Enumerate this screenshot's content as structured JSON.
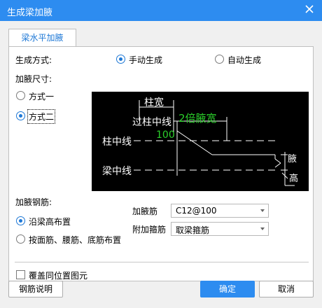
{
  "window": {
    "title": "生成梁加腋"
  },
  "tab": {
    "label": "梁水平加腋"
  },
  "generation": {
    "label": "生成方式:",
    "manual": "手动生成",
    "auto": "自动生成",
    "selected": "manual"
  },
  "size": {
    "label": "加腋尺寸:",
    "option1": "方式一",
    "option2": "方式二",
    "selected": "option2"
  },
  "diagram": {
    "col_width": "柱宽",
    "through_col_center": "过柱中线",
    "double_haunch_width": "2倍腋宽",
    "col_center_line": "柱中线",
    "value_100": "100",
    "beam_center_line": "梁中线",
    "haunch_label": "腋",
    "height_label": "高"
  },
  "rebar": {
    "label": "加腋钢筋:",
    "along_beam": "沿梁高布置",
    "by_face": "按面筋、腰筋、底筋布置",
    "selected": "along_beam",
    "haunch_rebar_label": "加腋筋",
    "haunch_rebar_value": "C12@100",
    "extra_stirrup_label": "附加箍筋",
    "extra_stirrup_value": "取梁箍筋"
  },
  "overwrite": {
    "label": "覆盖同位置图元",
    "checked": false
  },
  "footer": {
    "rebar_help": "钢筋说明",
    "ok": "确定",
    "cancel": "取消"
  },
  "colors": {
    "accent": "#2d8cf0",
    "diagram_green": "#2bd02b"
  }
}
